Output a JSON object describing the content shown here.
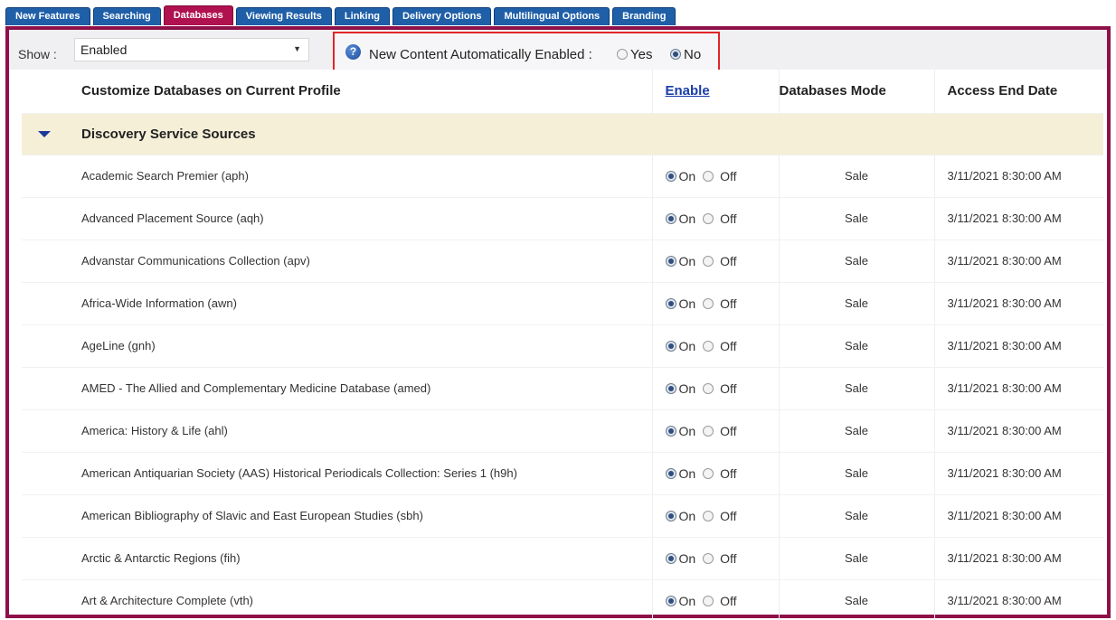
{
  "tabs": [
    {
      "label": "New Features",
      "active": false
    },
    {
      "label": "Searching",
      "active": false
    },
    {
      "label": "Databases",
      "active": true
    },
    {
      "label": "Viewing Results",
      "active": false
    },
    {
      "label": "Linking",
      "active": false
    },
    {
      "label": "Delivery Options",
      "active": false
    },
    {
      "label": "Multilingual Options",
      "active": false
    },
    {
      "label": "Branding",
      "active": false
    }
  ],
  "show": {
    "label": "Show :",
    "selected": "Enabled"
  },
  "auto_enable": {
    "label": "New Content Automatically Enabled :",
    "yes_label": "Yes",
    "no_label": "No",
    "selected": "No"
  },
  "table": {
    "headers": {
      "name": "Customize Databases on Current Profile",
      "enable": "Enable",
      "mode": "Databases Mode",
      "date": "Access End Date"
    },
    "group": "Discovery Service Sources",
    "on_label": "On",
    "off_label": "Off",
    "rows": [
      {
        "name": "Academic Search Premier (aph)",
        "state": "On",
        "mode": "Sale",
        "date": "3/11/2021 8:30:00 AM"
      },
      {
        "name": "Advanced Placement Source (aqh)",
        "state": "On",
        "mode": "Sale",
        "date": "3/11/2021 8:30:00 AM"
      },
      {
        "name": "Advanstar Communications Collection (apv)",
        "state": "On",
        "mode": "Sale",
        "date": "3/11/2021 8:30:00 AM"
      },
      {
        "name": "Africa-Wide Information (awn)",
        "state": "On",
        "mode": "Sale",
        "date": "3/11/2021 8:30:00 AM"
      },
      {
        "name": "AgeLine (gnh)",
        "state": "On",
        "mode": "Sale",
        "date": "3/11/2021 8:30:00 AM"
      },
      {
        "name": "AMED - The Allied and Complementary Medicine Database (amed)",
        "state": "On",
        "mode": "Sale",
        "date": "3/11/2021 8:30:00 AM"
      },
      {
        "name": "America: History & Life (ahl)",
        "state": "On",
        "mode": "Sale",
        "date": "3/11/2021 8:30:00 AM"
      },
      {
        "name": "American Antiquarian Society (AAS) Historical Periodicals Collection: Series 1 (h9h)",
        "state": "On",
        "mode": "Sale",
        "date": "3/11/2021 8:30:00 AM"
      },
      {
        "name": "American Bibliography of Slavic and East European Studies (sbh)",
        "state": "On",
        "mode": "Sale",
        "date": "3/11/2021 8:30:00 AM"
      },
      {
        "name": "Arctic & Antarctic Regions (fih)",
        "state": "On",
        "mode": "Sale",
        "date": "3/11/2021 8:30:00 AM"
      },
      {
        "name": "Art & Architecture Complete (vth)",
        "state": "On",
        "mode": "Sale",
        "date": "3/11/2021 8:30:00 AM"
      }
    ]
  }
}
